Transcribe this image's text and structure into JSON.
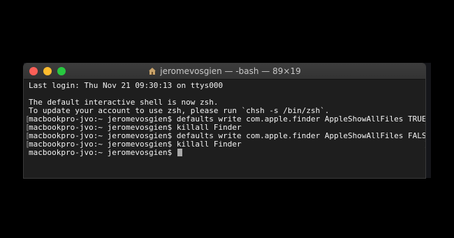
{
  "window": {
    "title": "jeromevosgien — -bash — 89×19"
  },
  "terminal": {
    "lines": [
      {
        "text": "Last login: Thu Nov 21 09:30:13 on ttys000",
        "marked": false
      },
      {
        "text": "",
        "marked": false
      },
      {
        "text": "The default interactive shell is now zsh.",
        "marked": false
      },
      {
        "text": "To update your account to use zsh, please run `chsh -s /bin/zsh`.",
        "marked": false
      },
      {
        "text": "macbookpro-jvo:~ jeromevosgien$ defaults write com.apple.finder AppleShowAllFiles TRUE",
        "marked": true
      },
      {
        "text": "macbookpro-jvo:~ jeromevosgien$ killall Finder",
        "marked": true
      },
      {
        "text": "macbookpro-jvo:~ jeromevosgien$ defaults write com.apple.finder AppleShowAllFiles FALSE",
        "marked": true
      },
      {
        "text": "macbookpro-jvo:~ jeromevosgien$ killall Finder",
        "marked": true
      }
    ],
    "prompt": "macbookpro-jvo:~ jeromevosgien$ ",
    "mark_left": "[",
    "mark_right": "]"
  }
}
